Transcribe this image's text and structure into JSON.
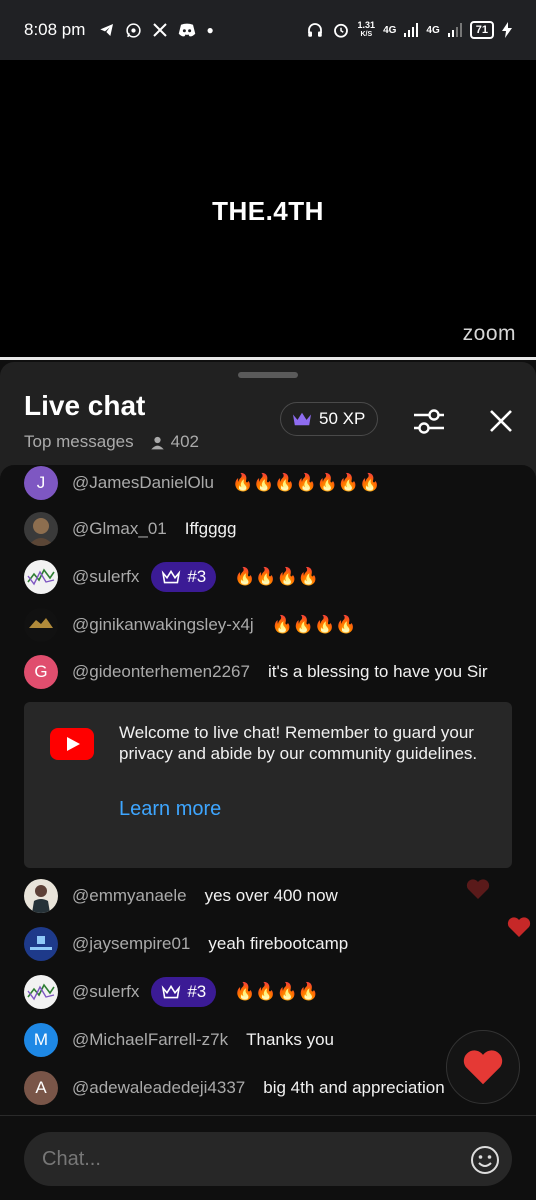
{
  "status_bar": {
    "time": "8:08 pm",
    "net_speed_value": "1.31",
    "net_speed_unit": "K/S",
    "network_1": "4G",
    "network_2": "4G",
    "battery": "71"
  },
  "video": {
    "title": "THE.4TH",
    "watermark": "zoom"
  },
  "chat_header": {
    "title": "Live chat",
    "mode": "Top messages",
    "viewer_count": "402",
    "xp": "50 XP"
  },
  "messages": [
    {
      "avatar_letter": "J",
      "avatar_color": "#7e57c2",
      "author": "@JamesDanielOlu",
      "text": "🔥🔥🔥🔥🔥🔥🔥"
    },
    {
      "avatar_letter": "",
      "avatar_color": "#5b4636",
      "author": "@Glmax_01",
      "text": "Iffgggg"
    },
    {
      "avatar_letter": "",
      "avatar_color": "#e8e8e8",
      "author": "@sulerfx",
      "rank": "#3",
      "text": "🔥🔥🔥🔥"
    },
    {
      "avatar_letter": "",
      "avatar_color": "#1a1a1a",
      "author": "@ginikanwakingsley-x4j",
      "text": "🔥🔥🔥🔥"
    },
    {
      "avatar_letter": "G",
      "avatar_color": "#e04e6e",
      "author": "@gideonterhemen2267",
      "text": "it's a blessing to have you Sir"
    }
  ],
  "welcome": {
    "text": "Welcome to live chat! Remember to guard your privacy and abide by our community guidelines.",
    "link": "Learn more"
  },
  "messages_after": [
    {
      "avatar_letter": "",
      "avatar_color": "#e9e4da",
      "author": "@emmyanaele",
      "text": "yes over 400 now"
    },
    {
      "avatar_letter": "",
      "avatar_color": "#1e3a8a",
      "author": "@jaysempire01",
      "text": "yeah firebootcamp"
    },
    {
      "avatar_letter": "",
      "avatar_color": "#e8e8e8",
      "author": "@sulerfx",
      "rank": "#3",
      "text": "🔥🔥🔥🔥"
    },
    {
      "avatar_letter": "M",
      "avatar_color": "#1e88e5",
      "author": "@MichaelFarrell-z7k",
      "text": "Thanks you"
    },
    {
      "avatar_letter": "A",
      "avatar_color": "#795548",
      "author": "@adewaleadedeji4337",
      "text": "big 4th and appreciation"
    }
  ],
  "input": {
    "placeholder": "Chat..."
  },
  "colors": {
    "accent_link": "#3ea6ff",
    "rank_badge": "#3b1b95",
    "youtube_red": "#ff0000",
    "heart": "#e53935"
  }
}
